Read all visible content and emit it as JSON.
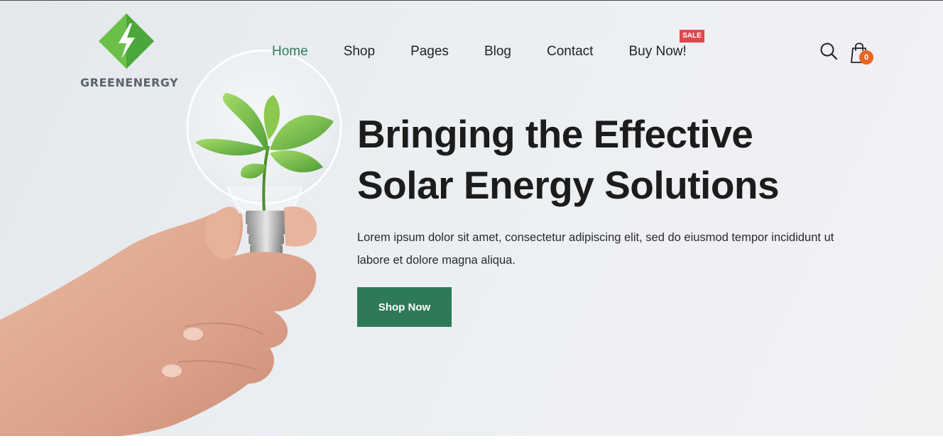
{
  "brand": {
    "name": "GREENENERGY",
    "colors": {
      "primary": "#2e7a57",
      "logo_green": "#6cc04a",
      "sale": "#e2474f",
      "cart_badge": "#e8651f"
    }
  },
  "nav": {
    "items": [
      {
        "label": "Home",
        "active": true
      },
      {
        "label": "Shop",
        "active": false
      },
      {
        "label": "Pages",
        "active": false
      },
      {
        "label": "Blog",
        "active": false
      },
      {
        "label": "Contact",
        "active": false
      },
      {
        "label": "Buy Now!",
        "active": false,
        "badge": "SALE"
      }
    ]
  },
  "header_icons": {
    "search": "search-icon",
    "cart": "shopping-bag-icon",
    "cart_count": "0"
  },
  "hero": {
    "title_line1": "Bringing the Effective",
    "title_line2": "Solar Energy Solutions",
    "description_line1": "Lorem ipsum dolor sit amet, consectetur adipiscing elit, sed do eiusmod tempor incididunt ut",
    "description_line2": "labore et dolore magna aliqua.",
    "cta_label": "Shop Now",
    "image": "hand-holding-lightbulb-with-plant"
  }
}
